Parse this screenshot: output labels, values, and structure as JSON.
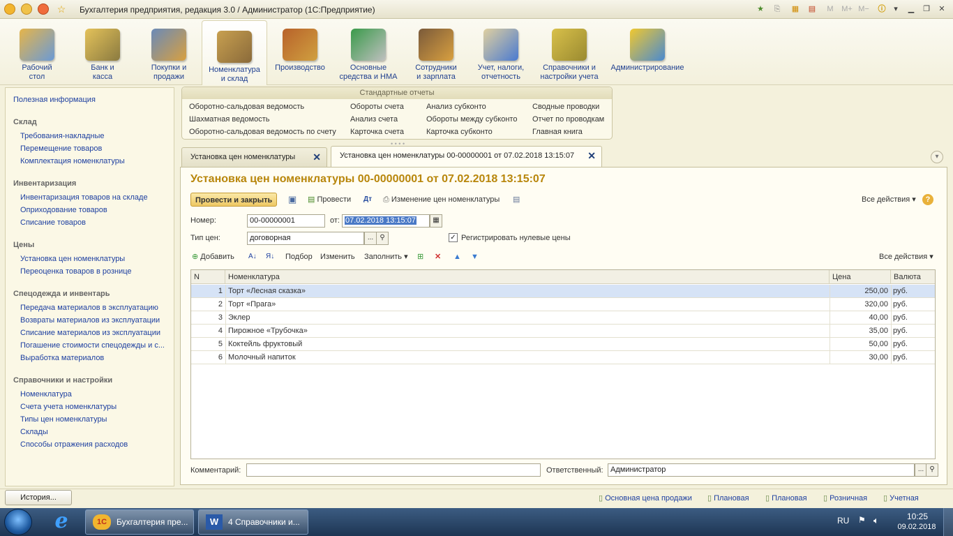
{
  "window": {
    "title": "Бухгалтерия предприятия, редакция 3.0 / Администратор  (1С:Предприятие)"
  },
  "sections": [
    {
      "label": "Рабочий\nстол",
      "icon": "desk-icon"
    },
    {
      "label": "Банк и\nкасса",
      "icon": "bank-icon"
    },
    {
      "label": "Покупки и\nпродажи",
      "icon": "truck-icon"
    },
    {
      "label": "Номенклатура\nи склад",
      "icon": "warehouse-icon"
    },
    {
      "label": "Производство",
      "icon": "tools-icon"
    },
    {
      "label": "Основные\nсредства и НМА",
      "icon": "assets-icon"
    },
    {
      "label": "Сотрудники\nи зарплата",
      "icon": "employee-icon"
    },
    {
      "label": "Учет, налоги,\nотчетность",
      "icon": "reports-icon"
    },
    {
      "label": "Справочники и\nнастройки учета",
      "icon": "folders-icon"
    },
    {
      "label": "Администрирование",
      "icon": "admin-icon"
    }
  ],
  "left_panel": {
    "useful": "Полезная информация",
    "groups": [
      {
        "title": "Склад",
        "items": [
          "Требования-накладные",
          "Перемещение товаров",
          "Комплектация номенклатуры"
        ]
      },
      {
        "title": "Инвентаризация",
        "items": [
          "Инвентаризация товаров на складе",
          "Оприходование товаров",
          "Списание товаров"
        ]
      },
      {
        "title": "Цены",
        "items": [
          "Установка цен номенклатуры",
          "Переоценка товаров в рознице"
        ]
      },
      {
        "title": "Спецодежда и инвентарь",
        "items": [
          "Передача материалов в эксплуатацию",
          "Возвраты материалов из эксплуатации",
          "Списание материалов из эксплуатации",
          "Погашение стоимости спецодежды и с...",
          "Выработка материалов"
        ]
      },
      {
        "title": "Справочники и настройки",
        "items": [
          "Номенклатура",
          "Счета учета номенклатуры",
          "Типы цен номенклатуры",
          "Склады",
          "Способы отражения расходов"
        ]
      }
    ]
  },
  "reports": {
    "header": "Стандартные отчеты",
    "columns": [
      [
        "Оборотно-сальдовая ведомость",
        "Шахматная ведомость",
        "Оборотно-сальдовая ведомость по счету"
      ],
      [
        "Обороты счета",
        "Анализ счета",
        "Карточка счета"
      ],
      [
        "Анализ субконто",
        "Обороты между субконто",
        "Карточка субконто"
      ],
      [
        "Сводные проводки",
        "Отчет по проводкам",
        "Главная книга"
      ]
    ]
  },
  "tabs": [
    {
      "label": "Установка цен номенклатуры"
    },
    {
      "label": "Установка цен номенклатуры 00-00000001 от 07.02.2018 13:15:07"
    }
  ],
  "doc": {
    "title": "Установка цен номенклатуры 00-00000001 от 07.02.2018 13:15:07",
    "btn_post_close": "Провести и закрыть",
    "btn_post": "Провести",
    "btn_change_prices": "Изменение цен номенклатуры",
    "all_actions": "Все действия",
    "number_label": "Номер:",
    "number_value": "00-00000001",
    "date_label": "от:",
    "date_value": "07.02.2018 13:15:07",
    "price_type_label": "Тип цен:",
    "price_type_value": "договорная",
    "register_zero": "Регистрировать нулевые цены",
    "tb_add": "Добавить",
    "tb_select": "Подбор",
    "tb_edit": "Изменить",
    "tb_fill": "Заполнить",
    "tb_all_actions": "Все действия",
    "comment_label": "Комментарий:",
    "comment_value": "",
    "responsible_label": "Ответственный:",
    "responsible_value": "Администратор"
  },
  "grid": {
    "columns": [
      "N",
      "Номенклатура",
      "Цена",
      "Валюта"
    ],
    "rows": [
      {
        "n": "1",
        "name": "Торт «Лесная сказка»",
        "price": "250,00",
        "currency": "руб."
      },
      {
        "n": "2",
        "name": "Торт «Прага»",
        "price": "320,00",
        "currency": "руб."
      },
      {
        "n": "3",
        "name": "Эклер",
        "price": "40,00",
        "currency": "руб."
      },
      {
        "n": "4",
        "name": "Пирожное «Трубочка»",
        "price": "35,00",
        "currency": "руб."
      },
      {
        "n": "5",
        "name": "Коктейль фруктовый",
        "price": "50,00",
        "currency": "руб."
      },
      {
        "n": "6",
        "name": "Молочный напиток",
        "price": "30,00",
        "currency": "руб."
      }
    ]
  },
  "statusbar": {
    "history": "История...",
    "links": [
      "Основная цена продажи",
      "Плановая",
      "Плановая",
      "Розничная",
      "Учетная"
    ]
  },
  "taskbar": {
    "tasks": [
      "Бухгалтерия пре...",
      "4 Справочники и..."
    ],
    "lang": "RU",
    "time": "10:25",
    "date": "09.02.2018"
  },
  "colors": {
    "accent": "#b8860b",
    "link": "#1d3fa0",
    "selection": "#d6e3f6"
  }
}
